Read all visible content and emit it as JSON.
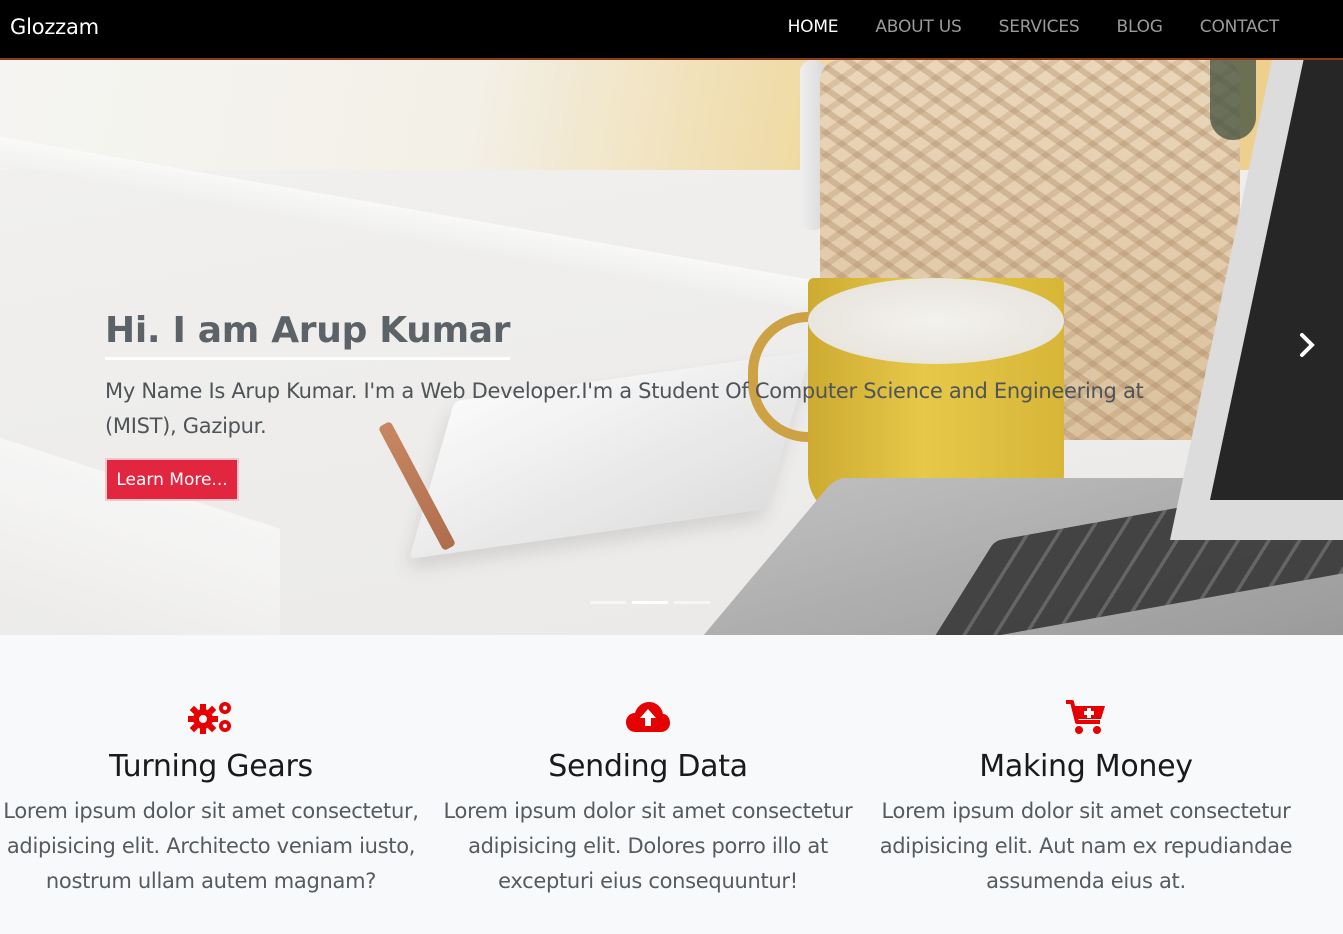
{
  "brand": "Glozzam",
  "nav": {
    "home": "HOME",
    "about": "ABOUT US",
    "services": "SERVICES",
    "blog": "BLOG",
    "contact": "CONTACT"
  },
  "hero": {
    "title": "Hi. I am Arup Kumar",
    "text": "My Name Is Arup Kumar. I'm a Web Developer.I'm a Student Of Computer Science and Engineering at (MIST), Gazipur.",
    "button": "Learn More...",
    "active_slide": 2,
    "slide_count": 3
  },
  "features": [
    {
      "icon": "gears-icon",
      "title": "Turning Gears",
      "text": "Lorem ipsum dolor sit amet consectetur, adipisicing elit. Architecto veniam iusto, nostrum ullam autem magnam?"
    },
    {
      "icon": "cloud-upload-icon",
      "title": "Sending Data",
      "text": "Lorem ipsum dolor sit amet consectetur adipisicing elit. Dolores porro illo at excepturi eius consequuntur!"
    },
    {
      "icon": "cart-plus-icon",
      "title": "Making Money",
      "text": "Lorem ipsum dolor sit amet consectetur adipisicing elit. Aut nam ex repudiandae assumenda eius at."
    }
  ],
  "colors": {
    "accent": "#e3263f",
    "icon": "#e60000",
    "navbar": "#000000"
  }
}
